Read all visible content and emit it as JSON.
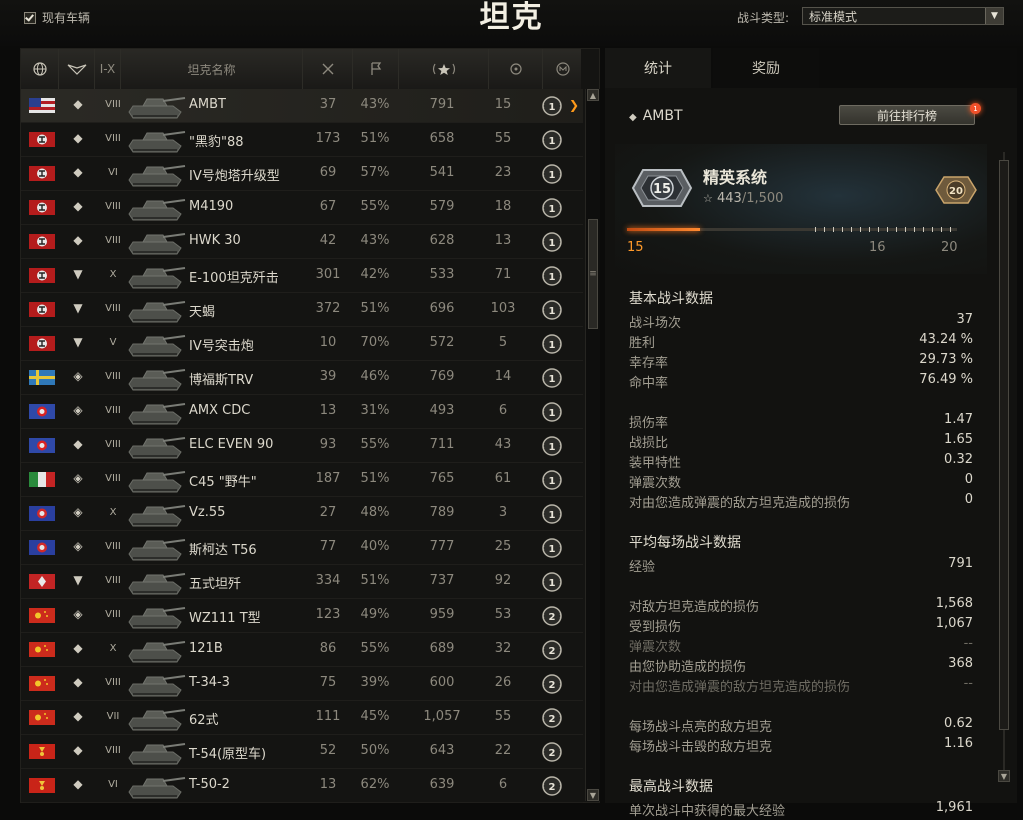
{
  "header": {
    "owned_label": "现有车辆",
    "title": "坦克",
    "battle_type_label": "战斗类型:",
    "battle_type_value": "标准模式"
  },
  "table": {
    "headers": {
      "tier": "I-X",
      "name": "坦克名称"
    },
    "rows": [
      {
        "flag": "usa",
        "type": "lt",
        "tier": "VIII",
        "name": "AMBT",
        "battles": "37",
        "winrate": "43%",
        "avg_exp": "791",
        "kills": "15",
        "mastery": "1",
        "selected": true
      },
      {
        "flag": "germany",
        "type": "lt",
        "tier": "VIII",
        "name": "\"黑豹\"88",
        "battles": "173",
        "winrate": "51%",
        "avg_exp": "658",
        "kills": "55",
        "mastery": "1"
      },
      {
        "flag": "germany",
        "type": "lt",
        "tier": "VI",
        "name": "IV号炮塔升级型",
        "battles": "69",
        "winrate": "57%",
        "avg_exp": "541",
        "kills": "23",
        "mastery": "1"
      },
      {
        "flag": "germany",
        "type": "lt",
        "tier": "VIII",
        "name": "M4190",
        "battles": "67",
        "winrate": "55%",
        "avg_exp": "579",
        "kills": "18",
        "mastery": "1"
      },
      {
        "flag": "germany",
        "type": "lt",
        "tier": "VIII",
        "name": "HWK 30",
        "battles": "42",
        "winrate": "43%",
        "avg_exp": "628",
        "kills": "13",
        "mastery": "1"
      },
      {
        "flag": "germany",
        "type": "td",
        "tier": "X",
        "name": "E-100坦克歼击",
        "battles": "301",
        "winrate": "42%",
        "avg_exp": "533",
        "kills": "71",
        "mastery": "1"
      },
      {
        "flag": "germany",
        "type": "td",
        "tier": "VIII",
        "name": "天蝎",
        "battles": "372",
        "winrate": "51%",
        "avg_exp": "696",
        "kills": "103",
        "mastery": "1"
      },
      {
        "flag": "germany",
        "type": "td",
        "tier": "V",
        "name": "IV号突击炮",
        "battles": "10",
        "winrate": "70%",
        "avg_exp": "572",
        "kills": "5",
        "mastery": "1"
      },
      {
        "flag": "sweden",
        "type": "mt",
        "tier": "VIII",
        "name": "博福斯TRV",
        "battles": "39",
        "winrate": "46%",
        "avg_exp": "769",
        "kills": "14",
        "mastery": "1"
      },
      {
        "flag": "france",
        "type": "mt",
        "tier": "VIII",
        "name": "AMX CDC",
        "battles": "13",
        "winrate": "31%",
        "avg_exp": "493",
        "kills": "6",
        "mastery": "1"
      },
      {
        "flag": "france",
        "type": "lt",
        "tier": "VIII",
        "name": "ELC EVEN 90",
        "battles": "93",
        "winrate": "55%",
        "avg_exp": "711",
        "kills": "43",
        "mastery": "1"
      },
      {
        "flag": "italy",
        "type": "mt",
        "tier": "VIII",
        "name": "C45 \"野牛\"",
        "battles": "187",
        "winrate": "51%",
        "avg_exp": "765",
        "kills": "61",
        "mastery": "1"
      },
      {
        "flag": "czech",
        "type": "mt",
        "tier": "X",
        "name": "Vz.55",
        "battles": "27",
        "winrate": "48%",
        "avg_exp": "789",
        "kills": "3",
        "mastery": "1"
      },
      {
        "flag": "czech",
        "type": "mt",
        "tier": "VIII",
        "name": "斯柯达 T56",
        "battles": "77",
        "winrate": "40%",
        "avg_exp": "777",
        "kills": "25",
        "mastery": "1"
      },
      {
        "flag": "japan",
        "type": "td",
        "tier": "VIII",
        "name": "五式坦歼",
        "battles": "334",
        "winrate": "51%",
        "avg_exp": "737",
        "kills": "92",
        "mastery": "1"
      },
      {
        "flag": "china",
        "type": "mt",
        "tier": "VIII",
        "name": "WZ111 T型",
        "battles": "123",
        "winrate": "49%",
        "avg_exp": "959",
        "kills": "53",
        "mastery": "2"
      },
      {
        "flag": "china",
        "type": "lt",
        "tier": "X",
        "name": "121B",
        "battles": "86",
        "winrate": "55%",
        "avg_exp": "689",
        "kills": "32",
        "mastery": "2"
      },
      {
        "flag": "china",
        "type": "lt",
        "tier": "VIII",
        "name": "T-34-3",
        "battles": "75",
        "winrate": "39%",
        "avg_exp": "600",
        "kills": "26",
        "mastery": "2"
      },
      {
        "flag": "china",
        "type": "lt",
        "tier": "VII",
        "name": "62式",
        "battles": "111",
        "winrate": "45%",
        "avg_exp": "1,057",
        "kills": "55",
        "mastery": "2"
      },
      {
        "flag": "ussr",
        "type": "lt",
        "tier": "VIII",
        "name": "T-54(原型车)",
        "battles": "52",
        "winrate": "50%",
        "avg_exp": "643",
        "kills": "22",
        "mastery": "2"
      },
      {
        "flag": "ussr",
        "type": "lt",
        "tier": "VI",
        "name": "T-50-2",
        "battles": "13",
        "winrate": "62%",
        "avg_exp": "639",
        "kills": "6",
        "mastery": "2"
      }
    ]
  },
  "panel": {
    "tabs": [
      "统计",
      "奖励"
    ],
    "tank_name": "AMBT",
    "ranking_button": "前往排行榜",
    "notification_count": "1",
    "elite": {
      "title": "精英系统",
      "level_badge": "15",
      "next_badge": "20",
      "xp": "443",
      "xp_total": "/1,500",
      "progress": 0.22,
      "level_current": "15",
      "level_next": "16",
      "level_max": "20"
    },
    "sections": [
      {
        "title": "基本战斗数据",
        "rows": [
          {
            "label": "战斗场次",
            "value": "37"
          },
          {
            "label": "胜利",
            "value": "43.24 %"
          },
          {
            "label": "幸存率",
            "value": "29.73 %"
          },
          {
            "label": "命中率",
            "value": "76.49 %"
          }
        ]
      },
      {
        "title": "",
        "rows": [
          {
            "label": "损伤率",
            "value": "1.47"
          },
          {
            "label": "战损比",
            "value": "1.65"
          },
          {
            "label": "装甲特性",
            "value": "0.32"
          },
          {
            "label": "弹震次数",
            "value": "0"
          },
          {
            "label": "对由您造成弹震的敌方坦克造成的损伤",
            "value": "0"
          }
        ]
      },
      {
        "title": "平均每场战斗数据",
        "rows": [
          {
            "label": "经验",
            "value": "791"
          }
        ]
      },
      {
        "title": "",
        "rows": [
          {
            "label": "对敌方坦克造成的损伤",
            "value": "1,568"
          },
          {
            "label": "受到损伤",
            "value": "1,067"
          },
          {
            "label": "弹震次数",
            "value": "--",
            "dim": true
          },
          {
            "label": "由您协助造成的损伤",
            "value": "368"
          },
          {
            "label": "对由您造成弹震的敌方坦克造成的损伤",
            "value": "--",
            "dim": true
          }
        ]
      },
      {
        "title": "",
        "rows": [
          {
            "label": "每场战斗点亮的敌方坦克",
            "value": "0.62"
          },
          {
            "label": "每场战斗击毁的敌方坦克",
            "value": "1.16"
          }
        ]
      },
      {
        "title": "最高战斗数据",
        "rows": [
          {
            "label": "单次战斗中获得的最大经验",
            "value": "1,961"
          }
        ]
      }
    ]
  }
}
